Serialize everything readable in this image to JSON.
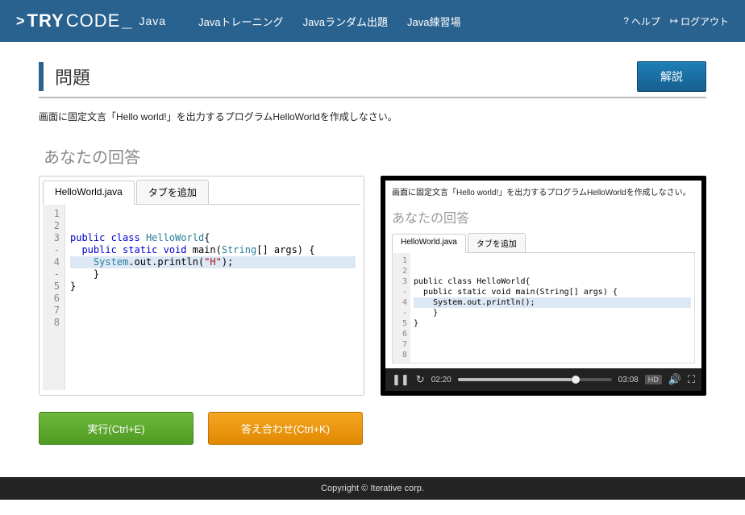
{
  "header": {
    "logo_prefix": ">",
    "logo_bold": "TRY",
    "logo_thin": "CODE",
    "logo_suffix": "_",
    "logo_sub": "Java",
    "nav": [
      "Javaトレーニング",
      "Javaランダム出題",
      "Java練習場"
    ],
    "help_label": "ヘルプ",
    "logout_label": "ログアウト"
  },
  "page": {
    "title": "問題",
    "explain_btn": "解説",
    "problem_desc": "画面に固定文言「Hello world!」を出力するプログラムHelloWorldを作成しなさい。",
    "answer_title": "あなたの回答"
  },
  "editor": {
    "tabs": [
      "HelloWorld.java",
      "タブを追加"
    ],
    "active_tab": 0,
    "line_numbers": [
      "1",
      "2",
      "3 -",
      "4 -",
      "5",
      "6",
      "7",
      "8"
    ],
    "highlighted_line": 5,
    "code_lines": [
      "",
      "",
      "public class HelloWorld{",
      "  public static void main(String[] args) {",
      "    System.out.println(\"H\");",
      "    }",
      "}",
      ""
    ]
  },
  "video": {
    "desc": "画面に固定文言「Hello world!」を出力するプログラムHelloWorldを作成しなさい。",
    "answer_title": "あなたの回答",
    "tabs": [
      "HelloWorld.java",
      "タブを追加"
    ],
    "line_numbers": [
      "1",
      "2",
      "3 -",
      "4 -",
      "5",
      "6",
      "7",
      "8"
    ],
    "highlighted_line": 5,
    "code_lines": [
      "",
      "",
      "public class HelloWorld{",
      "  public static void main(String[] args) {",
      "    System.out.println();",
      "    }",
      "}",
      ""
    ],
    "controls": {
      "current_time": "02:20",
      "duration": "03:08",
      "progress_pct": 74,
      "hd_label": "HD"
    }
  },
  "buttons": {
    "run": "実行(Ctrl+E)",
    "check": "答え合わせ(Ctrl+K)"
  },
  "footer": "Copyright © Iterative corp."
}
